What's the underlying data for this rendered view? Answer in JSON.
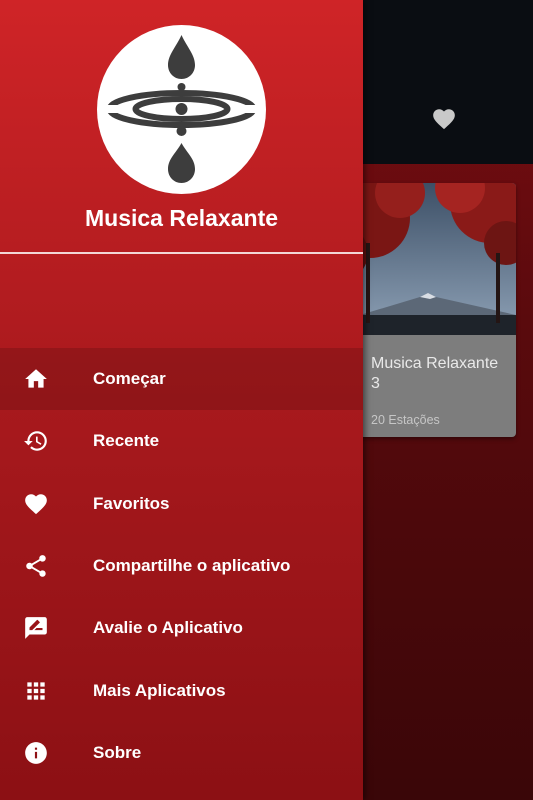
{
  "drawer": {
    "app_title": "Musica Relaxante",
    "items": [
      {
        "label": "Começar",
        "icon": "home-icon",
        "active": true
      },
      {
        "label": "Recente",
        "icon": "history-icon"
      },
      {
        "label": "Favoritos",
        "icon": "heart-icon"
      },
      {
        "label": "Compartilhe o aplicativo",
        "icon": "share-icon"
      },
      {
        "label": "Avalie o Aplicativo",
        "icon": "rate-review-icon"
      },
      {
        "label": "Mais Aplicativos",
        "icon": "apps-grid-icon"
      },
      {
        "label": "Sobre",
        "icon": "info-icon"
      }
    ]
  },
  "background": {
    "card": {
      "title": "Musica Relaxante 3",
      "subtitle": "20 Estações"
    }
  },
  "colors": {
    "drawer_top": "#cf2427",
    "drawer_bottom": "#8c1014",
    "toolbar": "#0a0d12"
  }
}
